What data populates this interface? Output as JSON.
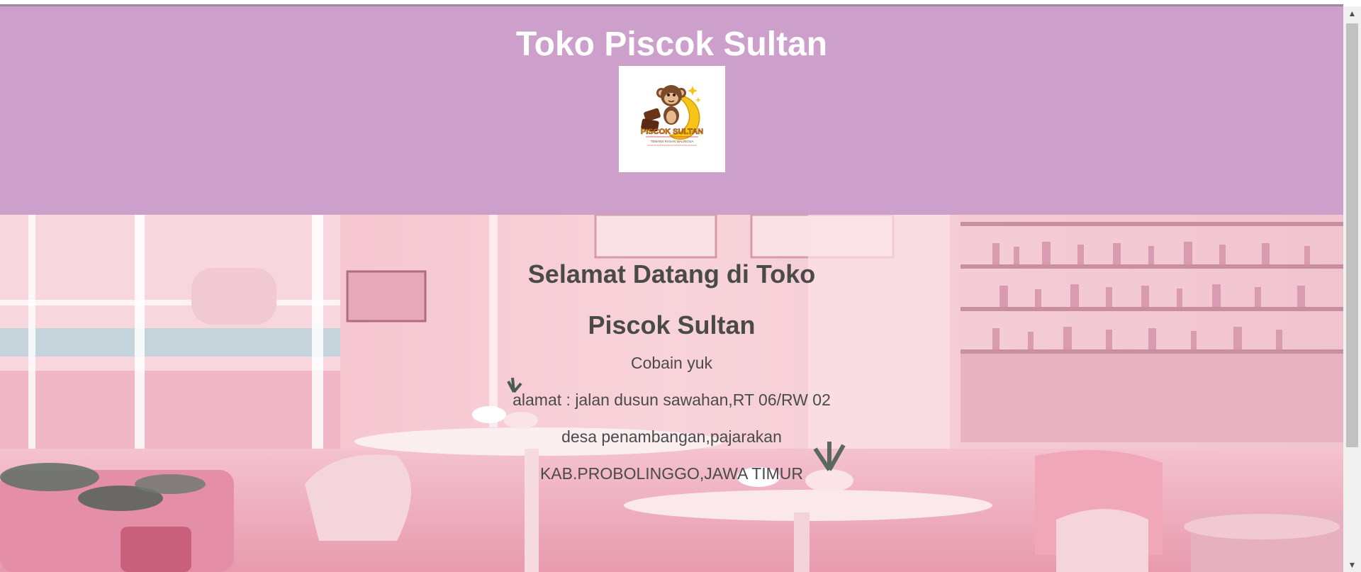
{
  "header": {
    "title": "Toko Piscok Sultan",
    "logo": {
      "brand_text": "PISCOK SULTAN",
      "tagline": "TEMANS RASAN WALINGGA",
      "icon": "monkey-banana-logo"
    }
  },
  "hero": {
    "welcome_line1": "Selamat Datang di Toko",
    "welcome_line2": "Piscok Sultan",
    "subtitle": "Cobain yuk",
    "address_line1": "alamat : jalan dusun sawahan,RT 06/RW 02",
    "address_line2": "desa penambangan,pajarakan",
    "address_line3": "KAB.PROBOLINGGO,JAWA TIMUR",
    "background": "pink-cafe-interior-illustration"
  },
  "scrollbar": {
    "up_icon": "arrow-up-icon",
    "down_icon": "arrow-down-icon"
  },
  "colors": {
    "header_bg": "#cda0cb",
    "title_text": "#ffffff",
    "hero_text": "#4a4a4a"
  }
}
